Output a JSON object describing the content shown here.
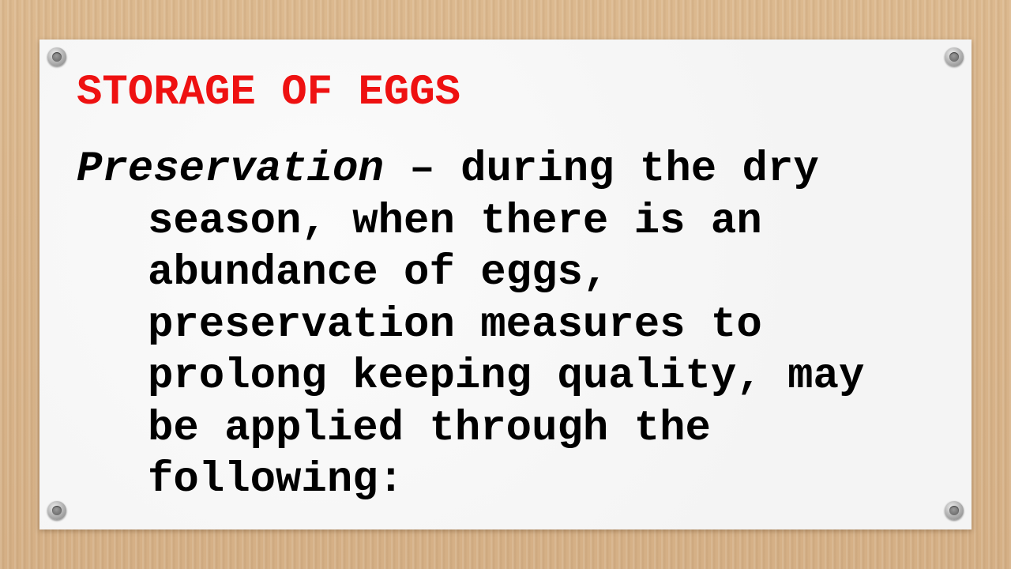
{
  "slide": {
    "title": "STORAGE OF EGGS",
    "term": "Preservation",
    "lines": [
      " – during the dry",
      "season, when there is an",
      "abundance of eggs,",
      "preservation measures to",
      "prolong keeping quality, may",
      "be applied through the",
      "following:"
    ]
  },
  "colors": {
    "title": "#ee1111",
    "text": "#000000",
    "card": "#f7f7f7",
    "background": "#d8b48a"
  }
}
